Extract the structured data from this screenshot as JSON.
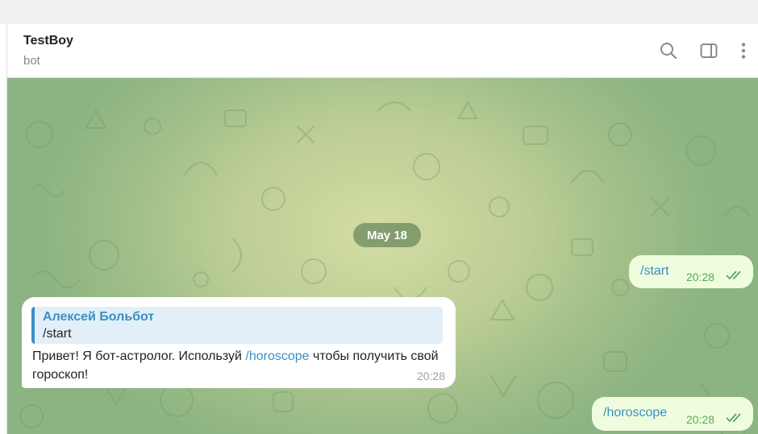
{
  "header": {
    "title": "TestBoy",
    "subtitle": "bot",
    "icons": [
      "search-icon",
      "sidebar-toggle-icon",
      "more-vertical-icon"
    ]
  },
  "chat": {
    "date_label": "May 18",
    "messages": [
      {
        "direction": "out",
        "text": "/start",
        "time": "20:28",
        "status": "read"
      },
      {
        "direction": "in",
        "reply_to": {
          "name": "Алексей Больбот",
          "text": "/start"
        },
        "text_before": "Привет! Я бот-астролог. Используй ",
        "command": "/horoscope",
        "text_after": " чтобы получить свой гороскоп!",
        "time": "20:28"
      },
      {
        "direction": "out",
        "text": "/horoscope",
        "time": "20:28",
        "status": "read"
      }
    ]
  },
  "colors": {
    "accent": "#3a8fc4",
    "outgoing_bubble": "#effdde",
    "outgoing_time": "#59a758",
    "chat_bg": "#bccd95"
  }
}
